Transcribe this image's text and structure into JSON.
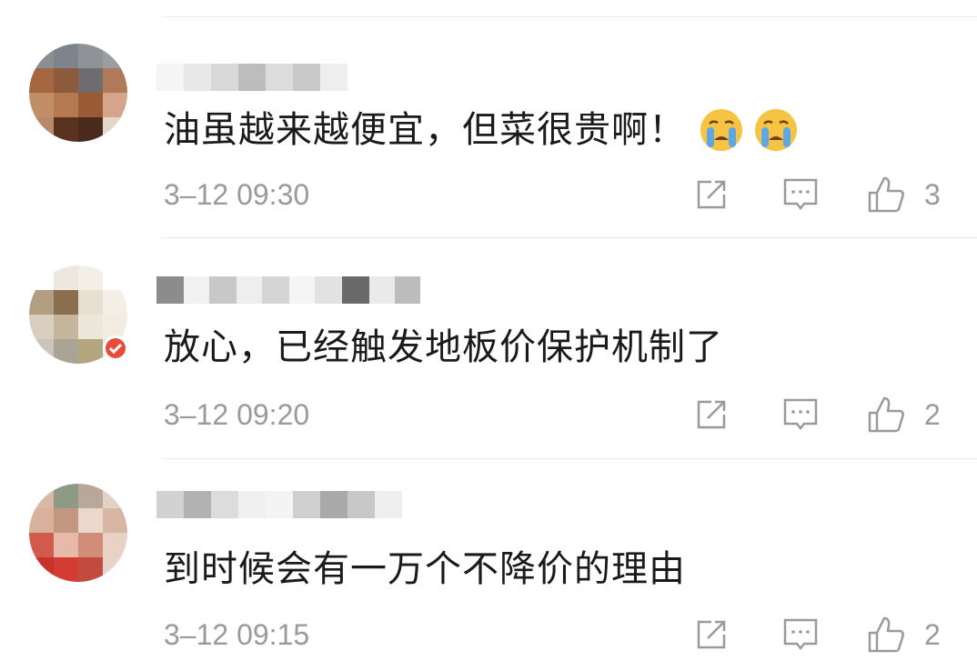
{
  "comments": [
    {
      "text": "油虽越来越便宜，但菜很贵啊！",
      "time": "3–12 09:30",
      "likes": "3",
      "emoji": [
        "crying-face-icon",
        "crying-face-icon"
      ]
    },
    {
      "text": "放心，已经触发地板价保护机制了",
      "time": "3–12 09:20",
      "likes": "2"
    },
    {
      "text": "到时候会有一万个不降价的理由",
      "time": "3–12 09:15",
      "likes": "2"
    }
  ],
  "colors": {
    "text": "#1a1a1a",
    "meta": "#9a9a9a",
    "divider": "#ebebeb"
  }
}
